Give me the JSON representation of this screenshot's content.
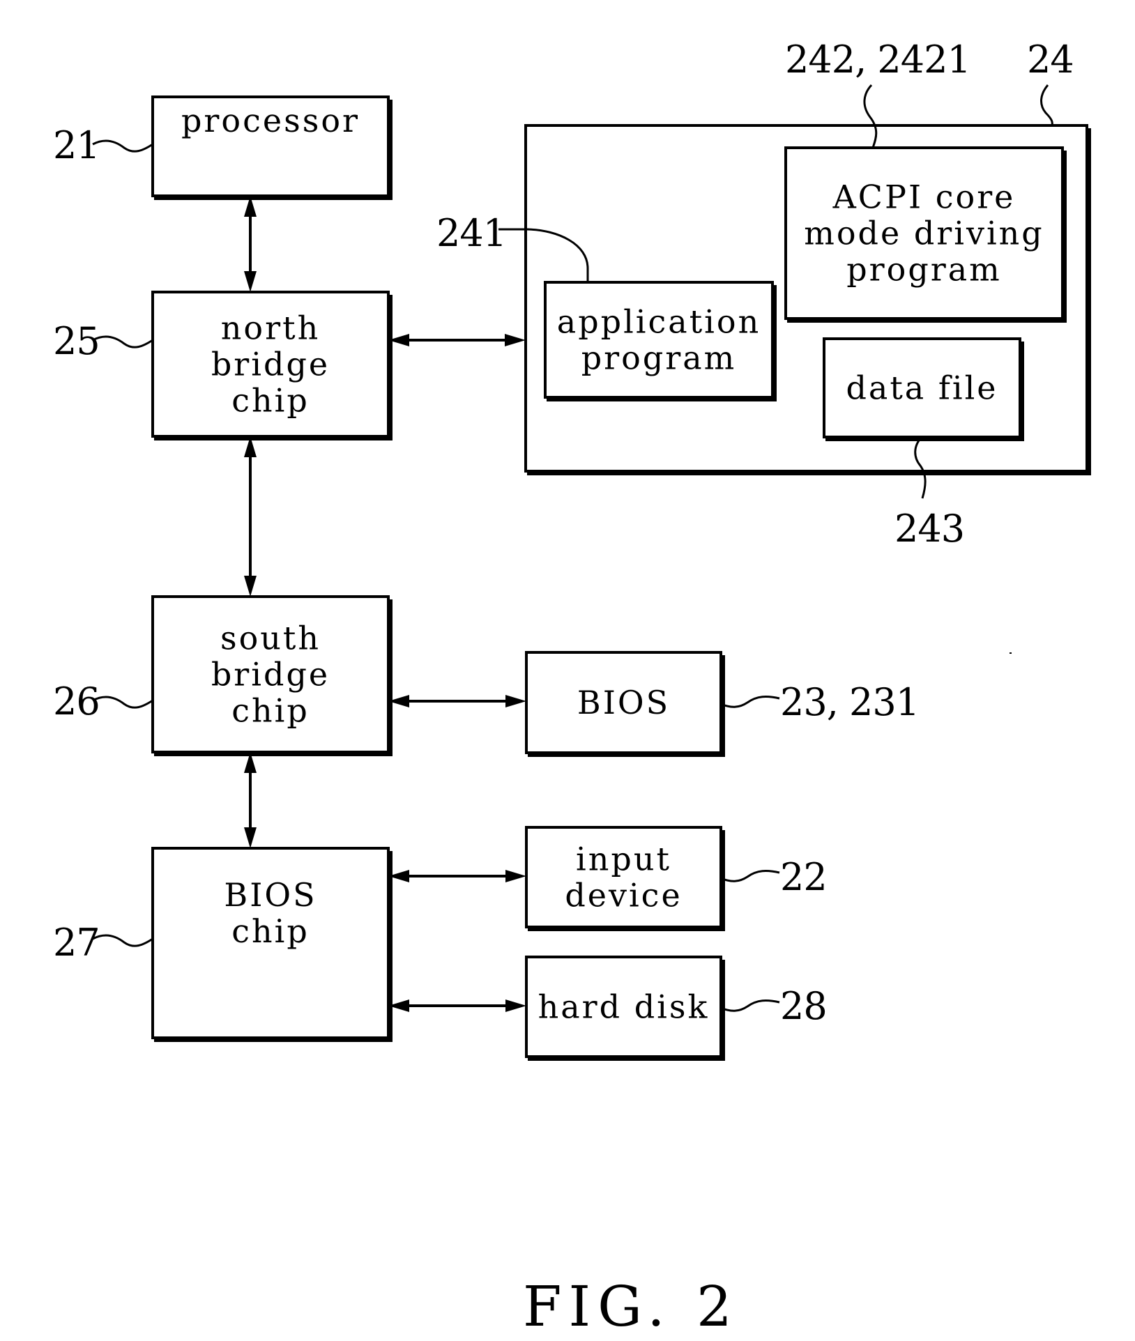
{
  "figure": {
    "caption": "FIG. 2",
    "background_color": "#ffffff",
    "ink_color": "#000000"
  },
  "blocks": {
    "processor": {
      "ref": "21",
      "lines": [
        "processor"
      ]
    },
    "north_bridge": {
      "ref": "25",
      "lines": [
        "north",
        "bridge",
        "chip"
      ]
    },
    "south_bridge": {
      "ref": "26",
      "lines": [
        "south",
        "bridge",
        "chip"
      ]
    },
    "bios_chip": {
      "ref": "27",
      "lines": [
        "BIOS",
        "chip"
      ]
    },
    "memory": {
      "ref": "24",
      "lines": []
    },
    "application_program": {
      "ref": "241",
      "lines": [
        "application",
        "program"
      ]
    },
    "acpi_driver": {
      "ref": "242, 2421",
      "lines": [
        "ACPI  core",
        "mode driving",
        "program"
      ]
    },
    "data_file": {
      "ref": "243",
      "lines": [
        "data  file"
      ]
    },
    "bios": {
      "ref": "23, 231",
      "lines": [
        "BIOS"
      ]
    },
    "input_device": {
      "ref": "22",
      "lines": [
        "input",
        "device"
      ]
    },
    "hard_disk": {
      "ref": "28",
      "lines": [
        "hard  disk"
      ]
    }
  },
  "connections": [
    {
      "from": "processor",
      "to": "north_bridge",
      "direction": "bidirectional"
    },
    {
      "from": "north_bridge",
      "to": "memory",
      "direction": "bidirectional"
    },
    {
      "from": "north_bridge",
      "to": "south_bridge",
      "direction": "bidirectional"
    },
    {
      "from": "south_bridge",
      "to": "bios",
      "direction": "bidirectional"
    },
    {
      "from": "south_bridge",
      "to": "bios_chip",
      "direction": "bidirectional"
    },
    {
      "from": "bios_chip",
      "to": "input_device",
      "direction": "bidirectional"
    },
    {
      "from": "bios_chip",
      "to": "hard_disk",
      "direction": "bidirectional"
    }
  ]
}
